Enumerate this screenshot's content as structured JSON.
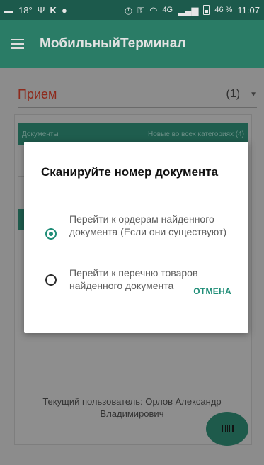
{
  "status_bar": {
    "temperature": "18°",
    "network": "4G",
    "battery": "46 %",
    "time": "11:07"
  },
  "app_bar": {
    "title": "МобильныйТерминал"
  },
  "operation": {
    "name": "Прием",
    "count": "(1)"
  },
  "documents_header": {
    "title": "Документы",
    "filter": "Новые во всех категориях (4)"
  },
  "current_user": "Текущий пользователь: Орлов Александр Владимирович",
  "dialog": {
    "title": "Сканируйте номер документа",
    "options": [
      {
        "label": "Перейти к ордерам найденного документа (Если они существуют)",
        "selected": true
      },
      {
        "label": "Перейти к перечню товаров найденного документа",
        "selected": false
      }
    ],
    "cancel_label": "ОТМЕНА"
  },
  "colors": {
    "accent": "#1f8d77",
    "app_bar": "#2a7c66",
    "operation_text": "#8e2a1c"
  }
}
